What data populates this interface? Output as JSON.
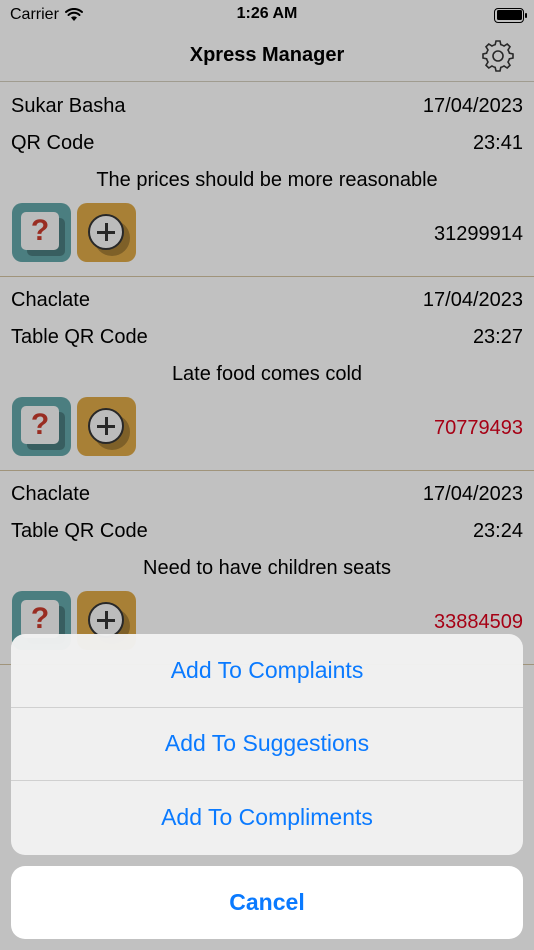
{
  "status_bar": {
    "carrier": "Carrier",
    "time": "1:26 AM"
  },
  "nav": {
    "title": "Xpress Manager"
  },
  "feedback_items": [
    {
      "name": "Sukar Basha",
      "date": "17/04/2023",
      "source": "QR Code",
      "time": "23:41",
      "message": "The prices should be more reasonable",
      "code": "31299914",
      "code_color": "#000000"
    },
    {
      "name": "Chaclate",
      "date": "17/04/2023",
      "source": "Table QR Code",
      "time": "23:27",
      "message": "Late food comes cold",
      "code": "70779493",
      "code_color": "#d0021b"
    },
    {
      "name": "Chaclate",
      "date": "17/04/2023",
      "source": "Table QR Code",
      "time": "23:24",
      "message": "Need to have children seats",
      "code": "33884509",
      "code_color": "#d0021b"
    }
  ],
  "action_sheet": {
    "options": [
      "Add To Complaints",
      "Add To Suggestions",
      "Add To Compliments"
    ],
    "cancel": "Cancel"
  },
  "colors": {
    "accent": "#0a7aff",
    "alert": "#d0021b",
    "tile_teal": "#5e9ea0",
    "tile_orange": "#d3a044"
  }
}
